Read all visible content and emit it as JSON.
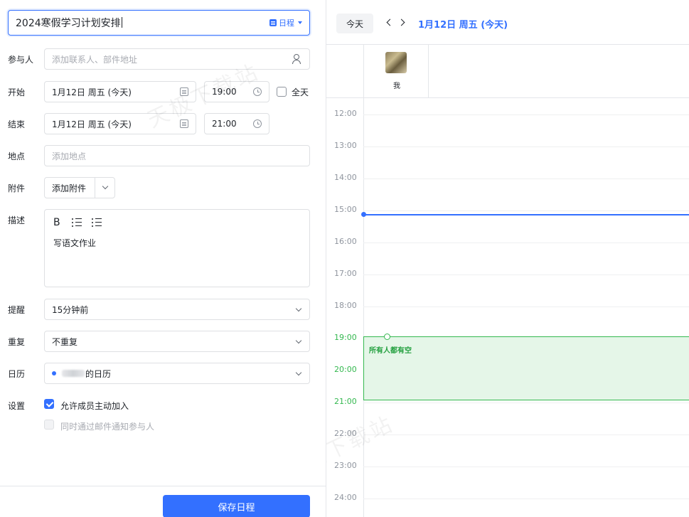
{
  "form": {
    "title_value": "2024寒假学习计划安排",
    "type_tag": "日程",
    "participants": {
      "label": "参与人",
      "placeholder": "添加联系人、部件地址"
    },
    "start": {
      "label": "开始",
      "date": "1月12日 周五 (今天)",
      "time": "19:00",
      "allday_label": "全天"
    },
    "end": {
      "label": "结束",
      "date": "1月12日 周五 (今天)",
      "time": "21:00"
    },
    "location": {
      "label": "地点",
      "placeholder": "添加地点"
    },
    "attachment": {
      "label": "附件",
      "button": "添加附件"
    },
    "description": {
      "label": "描述",
      "bold": "B",
      "text": "写语文作业"
    },
    "reminder": {
      "label": "提醒",
      "value": "15分钟前"
    },
    "repeat": {
      "label": "重复",
      "value": "不重复"
    },
    "calendar": {
      "label": "日历",
      "value": "的日历"
    },
    "settings": {
      "label": "设置",
      "allow_join": "允许成员主动加入",
      "notify_email": "同时通过邮件通知参与人"
    },
    "save_button": "保存日程"
  },
  "calendar_view": {
    "today_button": "今天",
    "date_title": "1月12日 周五 (今天)",
    "participant_name": "我",
    "hours": [
      "12:00",
      "13:00",
      "14:00",
      "15:00",
      "16:00",
      "17:00",
      "18:00",
      "19:00",
      "20:00",
      "21:00",
      "22:00",
      "23:00",
      "24:00"
    ],
    "event_label": "所有人都有空"
  },
  "watermark": "天极下载站",
  "colors": {
    "accent": "#3370ff",
    "free_green": "#34b84f",
    "free_bg": "#e5f6e8"
  }
}
